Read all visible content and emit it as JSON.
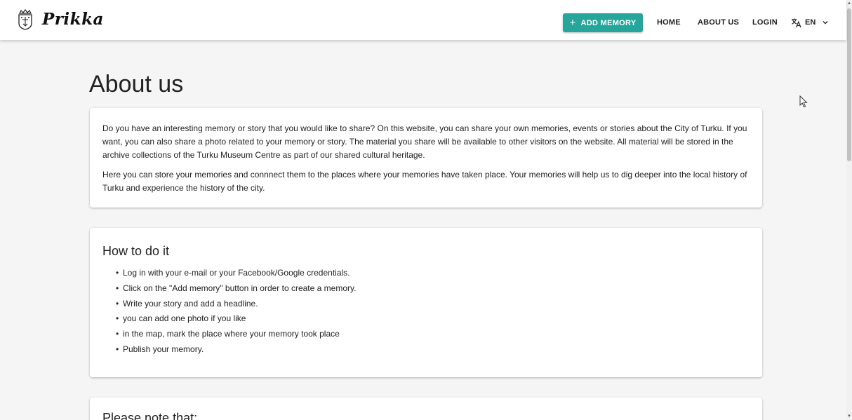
{
  "header": {
    "logo_text": "Prikka",
    "add_memory_label": "ADD MEMORY",
    "nav": {
      "home": "HOME",
      "about": "ABOUT US",
      "login": "LOGIN"
    },
    "language": "EN"
  },
  "main": {
    "title": "About us",
    "intro": {
      "paragraph1": "Do you have an interesting memory or story that you would like to share? On this website, you can share your own memories, events or stories about the City of Turku. If you want, you can also share a photo related to your memory or story. The material you share will be available to other visitors on the website. All material will be stored in the archive collections of the Turku Museum Centre as part of our shared cultural heritage.",
      "paragraph2": "Here you can store your memories and connnect them to the places where your memories have taken place. Your memories will help us to dig deeper into the local history of Turku and experience the history of the city."
    },
    "how_to": {
      "heading": "How to do it",
      "steps": [
        "Log in with your e-mail or your Facebook/Google credentials.",
        "Click on the \"Add memory\" button in order to create a memory.",
        "Write your story and add a headline.",
        "you can add one photo if you like",
        "in the map, mark the place where your memory took place",
        "Publish your memory."
      ]
    },
    "note": {
      "heading": "Please note that:"
    }
  },
  "colors": {
    "accent": "#26a69a",
    "background": "#f5f5f5",
    "card": "#ffffff"
  }
}
